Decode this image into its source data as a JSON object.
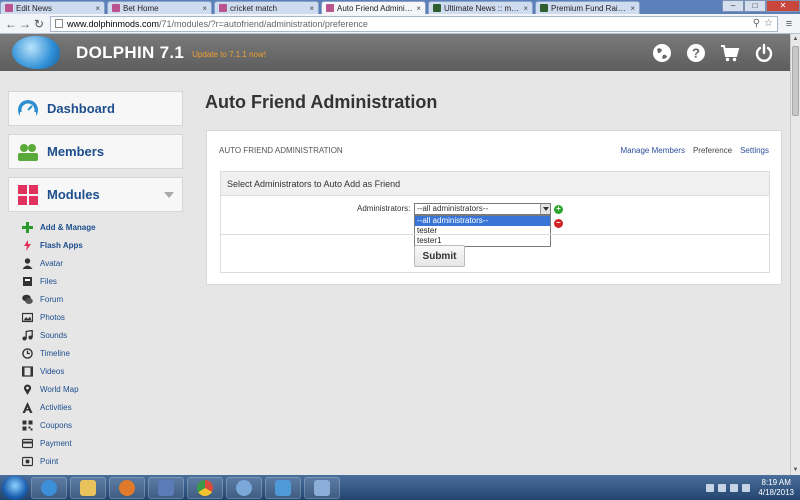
{
  "browser": {
    "tabs": [
      {
        "label": "Edit News",
        "color": "#b9558c",
        "active": false
      },
      {
        "label": "Bet Home",
        "color": "#b9558c",
        "active": false
      },
      {
        "label": "cricket match",
        "color": "#b9558c",
        "active": false
      },
      {
        "label": "Auto Friend Administratio",
        "color": "#b9558c",
        "active": true
      },
      {
        "label": "Ultimate News :: modzzz",
        "color": "#2e5d2e",
        "active": false
      },
      {
        "label": "Premium Fund Raiser :: m",
        "color": "#2e5d2e",
        "active": false
      }
    ],
    "tab_close": "×",
    "window_controls": {
      "minimize": "–",
      "maximize": "□",
      "close": "✕"
    },
    "url_host": "www.dolphinmods.com",
    "url_rest": "/71/modules/?r=autofriend/administration/preference",
    "icons": {
      "back": "arrow-left-icon",
      "forward": "arrow-right-icon",
      "reload": "reload-icon",
      "zoom": "zoom-icon",
      "star": "star-icon",
      "menu": "menu-icon"
    }
  },
  "site": {
    "title": "DOLPHIN 7.1",
    "update_link": "Update to 7.1.1 now!",
    "header_icons": [
      "globe-icon",
      "help-icon",
      "cart-icon",
      "power-icon"
    ]
  },
  "sidebar": {
    "dashboard": "Dashboard",
    "members": "Members",
    "modules": "Modules",
    "items": [
      {
        "label": "Add & Manage",
        "icon": "plus-icon",
        "bold": true
      },
      {
        "label": "Flash Apps",
        "icon": "flash-icon",
        "bold": true
      },
      {
        "label": "Avatar",
        "icon": "avatar-icon",
        "bold": false
      },
      {
        "label": "Files",
        "icon": "files-icon",
        "bold": false
      },
      {
        "label": "Forum",
        "icon": "forum-icon",
        "bold": false
      },
      {
        "label": "Photos",
        "icon": "photos-icon",
        "bold": false
      },
      {
        "label": "Sounds",
        "icon": "sounds-icon",
        "bold": false
      },
      {
        "label": "Timeline",
        "icon": "timeline-icon",
        "bold": false
      },
      {
        "label": "Videos",
        "icon": "videos-icon",
        "bold": false
      },
      {
        "label": "World Map",
        "icon": "map-pin-icon",
        "bold": false
      },
      {
        "label": "Activities",
        "icon": "activities-icon",
        "bold": false
      },
      {
        "label": "Coupons",
        "icon": "coupons-icon",
        "bold": false
      },
      {
        "label": "Payment",
        "icon": "payment-icon",
        "bold": false
      },
      {
        "label": "Point",
        "icon": "point-icon",
        "bold": false
      }
    ]
  },
  "main": {
    "page_title": "Auto Friend Administration",
    "panel_title": "AUTO FRIEND ADMINISTRATION",
    "links": {
      "manage_members": "Manage Members",
      "preference": "Preference",
      "settings": "Settings"
    },
    "section_title": "Select Administrators to Auto Add as Friend",
    "field_label": "Administrators:",
    "select_value": "--all administrators--",
    "options": [
      "--all administrators--",
      "tester",
      "tester1"
    ],
    "add_symbol": "+",
    "remove_symbol": "–",
    "submit_label": "Submit"
  },
  "taskbar": {
    "apps": [
      {
        "name": "taskbar-ie",
        "color": "#3c8fd8"
      },
      {
        "name": "taskbar-explorer",
        "color": "#e8c25a"
      },
      {
        "name": "taskbar-media",
        "color": "#e07a2a"
      },
      {
        "name": "taskbar-app4",
        "color": "#5a7ab8"
      },
      {
        "name": "taskbar-chrome",
        "color": "#d94b3a"
      },
      {
        "name": "taskbar-app6",
        "color": "#7aa8d8"
      },
      {
        "name": "taskbar-app7",
        "color": "#4e9ad8"
      },
      {
        "name": "taskbar-paint",
        "color": "#8aaed8"
      }
    ],
    "time": "8:19 AM",
    "date": "4/18/2013"
  },
  "colors": {
    "accent": "#1d4e8e",
    "link": "#2b4f9a",
    "update": "#f0a030",
    "selected_option": "#3875d7"
  }
}
